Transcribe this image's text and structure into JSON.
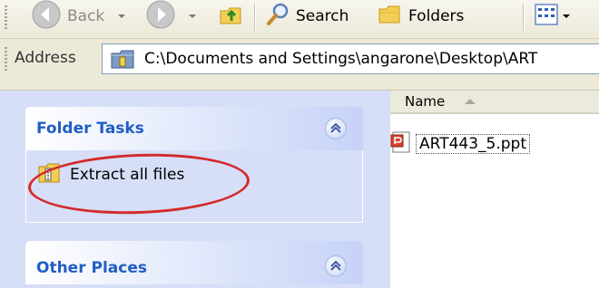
{
  "toolbar": {
    "back_label": "Back",
    "search_label": "Search",
    "folders_label": "Folders",
    "icons": [
      "back-arrow-icon",
      "forward-arrow-icon",
      "up-folder-icon",
      "search-magnifier-icon",
      "folders-icon",
      "views-icon"
    ]
  },
  "address": {
    "label": "Address",
    "path": "C:\\Documents and Settings\\angarone\\Desktop\\ART"
  },
  "task_pane": {
    "groups": [
      {
        "title": "Folder Tasks",
        "tasks": [
          {
            "label": "Extract all files",
            "icon": "zip-folder-icon"
          }
        ]
      },
      {
        "title": "Other Places",
        "tasks": []
      }
    ],
    "annotation_color": "#d42a2a"
  },
  "file_list": {
    "columns": [
      {
        "label": "Name",
        "sort": "ascending"
      }
    ],
    "files": [
      {
        "name": "ART443_5.ppt",
        "icon": "powerpoint-file-icon"
      }
    ]
  },
  "colors": {
    "task_header_text": "#215dc6",
    "task_pane_bg": "#d6dff7",
    "toolbar_bg": "#ece9d8"
  }
}
